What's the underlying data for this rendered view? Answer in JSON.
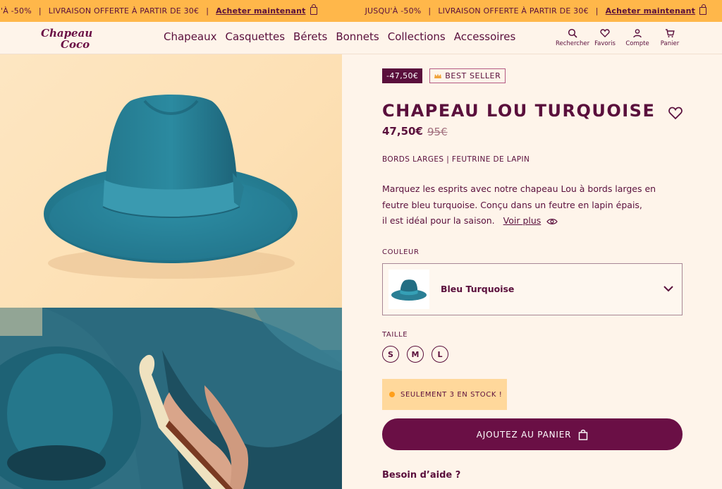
{
  "promo": {
    "text1": "JUSQU'À -50%",
    "sep": "|",
    "text2": "LIVRAISON OFFERTE À PARTIR DE 30€",
    "cta": "Acheter maintenant"
  },
  "brand": {
    "logo_line1": "Chapeau",
    "logo_line2": "Coco"
  },
  "nav": [
    "Chapeaux",
    "Casquettes",
    "Bérets",
    "Bonnets",
    "Collections",
    "Accessoires"
  ],
  "tools": [
    {
      "label": "Rechercher",
      "icon": "search-icon"
    },
    {
      "label": "Favoris",
      "icon": "heart-icon"
    },
    {
      "label": "Compte",
      "icon": "user-icon"
    },
    {
      "label": "Panier",
      "icon": "cart-icon"
    }
  ],
  "product": {
    "discount_badge": "-47,50€",
    "bestseller_badge": "BEST SELLER",
    "title": "CHAPEAU LOU TURQUOISE",
    "price": "47,50€",
    "old_price": "95€",
    "tags": "BORDS LARGES  |  FEUTRINE DE LAPIN",
    "description_l1": "Marquez les esprits avec notre chapeau Lou à bords larges en",
    "description_l2": "feutre bleu turquoise. Conçu dans un feutre en lapin épais,",
    "description_l3": "il est idéal pour la saison.",
    "see_more": "Voir plus",
    "color_label": "COULEUR",
    "color_value": "Bleu Turquoise",
    "size_label": "TAILLE",
    "sizes": [
      "S",
      "M",
      "L"
    ],
    "stock": "SEULEMENT 3 EN STOCK !",
    "add_to_cart": "AJOUTEZ AU PANIER",
    "help": "Besoin d’aide ?"
  },
  "colors": {
    "accent": "#5a0f3c",
    "promo_bg": "#ffb74a",
    "hat": "#2c8ea3"
  }
}
